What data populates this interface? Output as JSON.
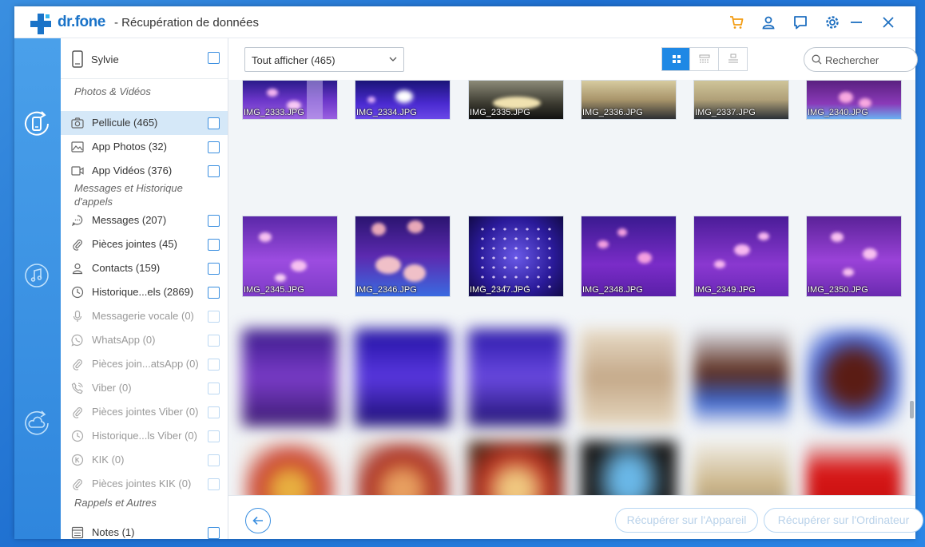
{
  "app": {
    "brand": "dr.fone",
    "title": "- Récupération de données"
  },
  "titlebar_icons": [
    "cart-icon",
    "user-icon",
    "chat-icon",
    "settings-icon",
    "minimize-icon",
    "close-icon"
  ],
  "colors": {
    "accent": "#1e88e5",
    "brand": "#1a73c8",
    "cart": "#f39c12"
  },
  "nav": [
    "phone-recovery-icon",
    "itunes-recovery-icon",
    "icloud-recovery-icon"
  ],
  "sidebar": {
    "device": "Sylvie",
    "sections": {
      "photos": "Photos & Vidéos",
      "messages": "Messages et Historique d'appels",
      "reminders": "Rappels et Autres"
    },
    "items": [
      {
        "label": "Pellicule (465)",
        "icon": "camera-icon"
      },
      {
        "label": "App Photos (32)",
        "icon": "image-icon"
      },
      {
        "label": "App Vidéos (376)",
        "icon": "video-icon"
      },
      {
        "label": "Messages (207)",
        "icon": "message-icon"
      },
      {
        "label": "Pièces jointes (45)",
        "icon": "paperclip-icon"
      },
      {
        "label": "Contacts (159)",
        "icon": "contact-icon"
      },
      {
        "label": "Historique...els (2869)",
        "icon": "clock-icon"
      },
      {
        "label": "Messagerie vocale (0)",
        "icon": "mic-icon"
      },
      {
        "label": "WhatsApp (0)",
        "icon": "whatsapp-icon"
      },
      {
        "label": "Pièces join...atsApp (0)",
        "icon": "paperclip-icon"
      },
      {
        "label": "Viber (0)",
        "icon": "viber-icon"
      },
      {
        "label": "Pièces jointes Viber (0)",
        "icon": "paperclip-icon"
      },
      {
        "label": "Historique...ls Viber (0)",
        "icon": "clock-icon"
      },
      {
        "label": "KIK (0)",
        "icon": "kik-icon"
      },
      {
        "label": "Pièces jointes KIK (0)",
        "icon": "paperclip-icon"
      },
      {
        "label": "Notes (1)",
        "icon": "notes-icon"
      }
    ]
  },
  "toolbar": {
    "filter_value": "Tout afficher (465)",
    "search_placeholder": "Rechercher"
  },
  "photos": {
    "row1": [
      "IMG_2333.JPG",
      "IMG_2334.JPG",
      "IMG_2335.JPG",
      "IMG_2336.JPG",
      "IMG_2337.JPG",
      "IMG_2340.JPG"
    ],
    "row2": [
      "IMG_2345.JPG",
      "IMG_2346.JPG",
      "IMG_2347.JPG",
      "IMG_2348.JPG",
      "IMG_2349.JPG",
      "IMG_2350.JPG"
    ]
  },
  "footer": {
    "recover_device": "Récupérer sur l'Appareil",
    "recover_computer": "Récupérer sur l'Ordinateur"
  }
}
